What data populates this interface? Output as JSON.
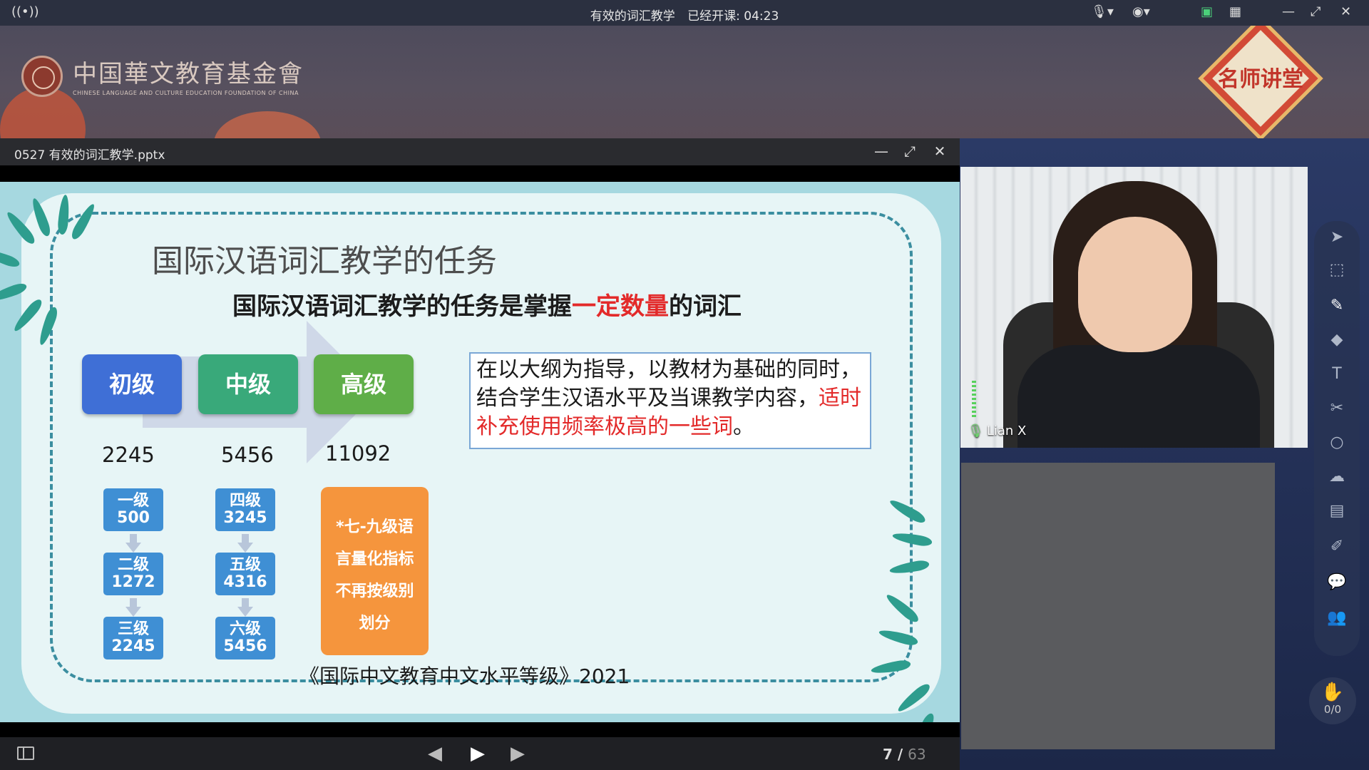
{
  "topbar": {
    "course_title": "有效的词汇教学",
    "elapsed_label": "已经开课: 04:23",
    "icons": [
      "broadcast-icon",
      "mic-icon",
      "camera-icon",
      "record-icon",
      "grid-icon",
      "minimize-icon",
      "restore-icon",
      "close-icon"
    ]
  },
  "banner": {
    "org_name": "中国華文教育基金會",
    "org_english": "CHINESE LANGUAGE AND CULTURE EDUCATION FOUNDATION OF CHINA",
    "badge_text": "名师讲堂"
  },
  "ppt": {
    "filename": "0527 有效的词汇教学.pptx",
    "current_page": "7",
    "page_separator": "/",
    "total_pages": "63"
  },
  "slide": {
    "title": "国际汉语词汇教学的任务",
    "subtitle_pre": "国际汉语词汇教学的任务是掌握",
    "subtitle_red": "一定数量",
    "subtitle_post": "的词汇",
    "levels": [
      {
        "name": "初级",
        "total": "2245",
        "color": "#3f6fd6"
      },
      {
        "name": "中级",
        "total": "5456",
        "color": "#39a97a"
      },
      {
        "name": "高级",
        "total": "11092",
        "color": "#5fae48"
      }
    ],
    "sub_primary": [
      {
        "lv": "一级",
        "n": "500"
      },
      {
        "lv": "二级",
        "n": "1272"
      },
      {
        "lv": "三级",
        "n": "2245"
      }
    ],
    "sub_middle": [
      {
        "lv": "四级",
        "n": "3245"
      },
      {
        "lv": "五级",
        "n": "4316"
      },
      {
        "lv": "六级",
        "n": "5456"
      }
    ],
    "advanced_note": [
      "*七-九级语",
      "言量化指标",
      "不再按级别",
      "划分"
    ],
    "textbox_black": "在以大纲为指导，以教材为基础的同时，结合学生汉语水平及当课教学内容，",
    "textbox_red": "适时补充使用频率极高的一些词",
    "textbox_end": "。",
    "caption": "《国际中文教育中文水平等级》2021"
  },
  "camera": {
    "participant_name": "Lian X"
  },
  "handup": {
    "count": "0/0"
  }
}
